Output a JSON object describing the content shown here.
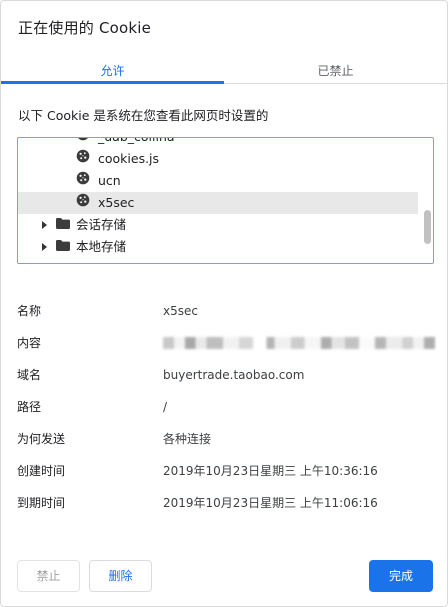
{
  "dialog": {
    "title": "正在使用的 Cookie"
  },
  "tabs": [
    {
      "label": "允许",
      "active": true
    },
    {
      "label": "已禁止",
      "active": false
    }
  ],
  "allowed": {
    "caption": "以下 Cookie 是系统在您查看此网页时设置的",
    "tree": {
      "items": [
        {
          "type": "cookie",
          "label": "_uab_collina",
          "selected": false
        },
        {
          "type": "cookie",
          "label": "cookies.js",
          "selected": false
        },
        {
          "type": "cookie",
          "label": "ucn",
          "selected": false
        },
        {
          "type": "cookie",
          "label": "x5sec",
          "selected": true
        },
        {
          "type": "folder",
          "label": "会话存储",
          "expanded": false
        },
        {
          "type": "folder",
          "label": "本地存储",
          "expanded": false
        }
      ]
    }
  },
  "details": {
    "name": {
      "label": "名称",
      "value": "x5sec"
    },
    "content": {
      "label": "内容",
      "value": "",
      "obscured": true
    },
    "domain": {
      "label": "域名",
      "value": "buyertrade.taobao.com"
    },
    "path": {
      "label": "路径",
      "value": "/"
    },
    "send_for": {
      "label": "为何发送",
      "value": "各种连接"
    },
    "created": {
      "label": "创建时间",
      "value": "2019年10月23日星期三 上午10:36:16"
    },
    "expires": {
      "label": "到期时间",
      "value": "2019年10月23日星期三 上午11:06:16"
    }
  },
  "buttons": {
    "block": "禁止",
    "delete": "删除",
    "done": "完成"
  },
  "colors": {
    "accent": "#1a73e8",
    "selected_row": "#e8e8e8",
    "tree_border": "#7aa0de"
  }
}
